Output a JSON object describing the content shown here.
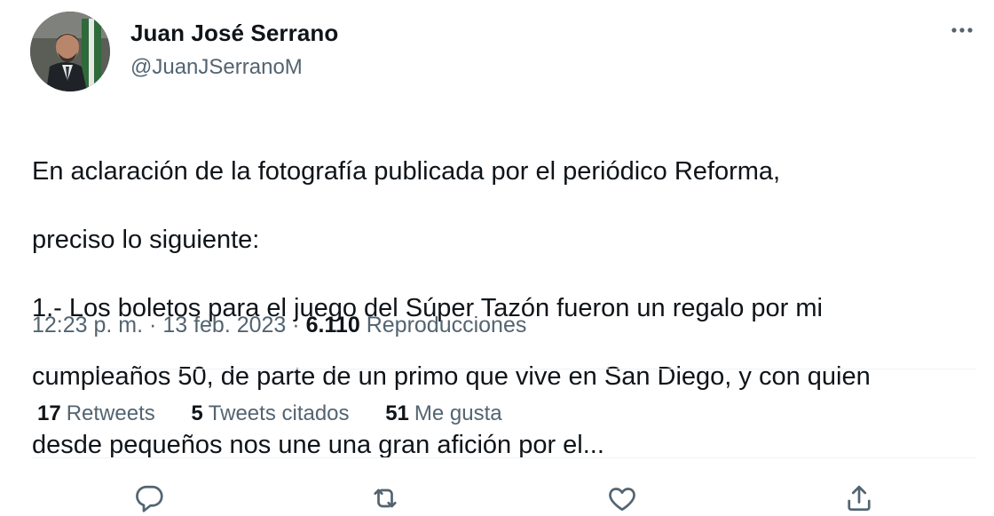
{
  "author": {
    "display_name": "Juan José Serrano",
    "handle": "@JuanJSerranoM"
  },
  "tweet": {
    "lines": [
      "En aclaración de la fotografía publicada por el periódico Reforma,",
      "preciso lo siguiente:",
      "1.- Los boletos para el juego del Súper Tazón fueron un regalo por mi",
      "cumpleaños 50, de parte de un primo que vive en San Diego, y con quien",
      "desde pequeños nos une una gran afición por el..."
    ],
    "time": "12:23 p. m.",
    "date": "13 feb. 2023",
    "separator": "·",
    "views_count": "6.110",
    "views_label": "Reproducciones"
  },
  "stats": [
    {
      "count": "17",
      "label": "Retweets"
    },
    {
      "count": "5",
      "label": "Tweets citados"
    },
    {
      "count": "51",
      "label": "Me gusta"
    }
  ],
  "actions": [
    {
      "icon": "reply-icon"
    },
    {
      "icon": "retweet-icon"
    },
    {
      "icon": "like-icon"
    },
    {
      "icon": "share-icon"
    }
  ],
  "more_icon": "more-options-icon",
  "colors": {
    "text_primary": "#0f1419",
    "text_secondary": "#536471",
    "divider": "#eff3f4"
  }
}
